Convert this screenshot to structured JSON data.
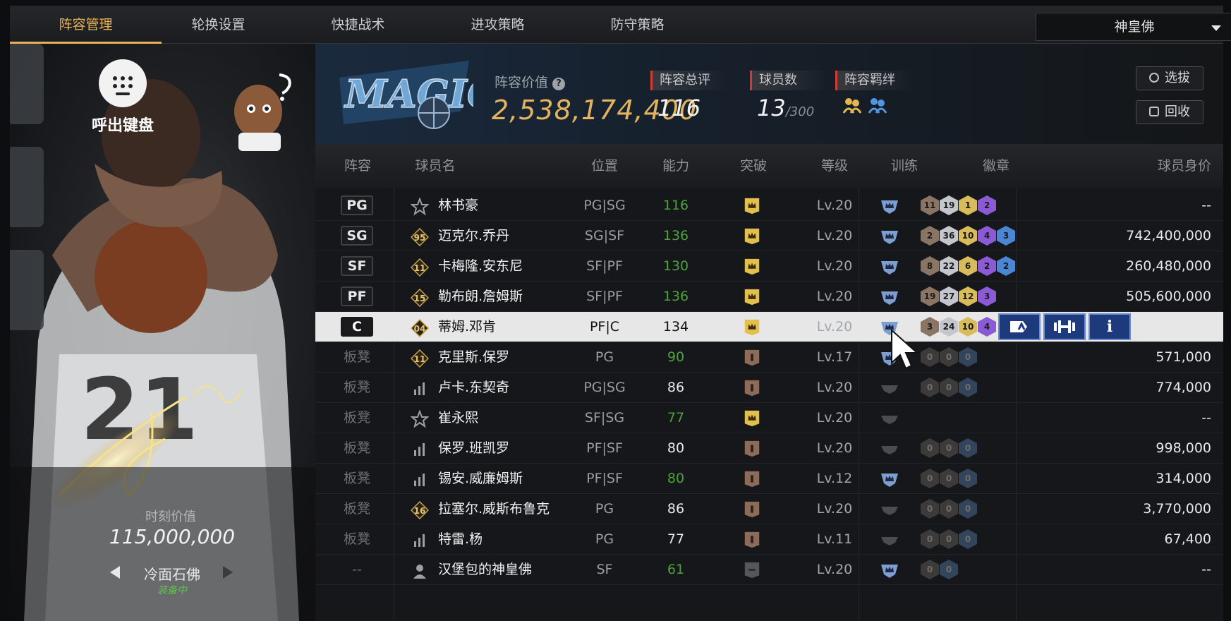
{
  "tabs": [
    {
      "label": "阵容管理",
      "active": true
    },
    {
      "label": "轮换设置",
      "active": false
    },
    {
      "label": "快捷战术",
      "active": false
    },
    {
      "label": "进攻策略",
      "active": false
    },
    {
      "label": "防守策略",
      "active": false
    }
  ],
  "dropdown": {
    "value": "神皇佛"
  },
  "left_panel": {
    "keyboard_label": "呼出键盘",
    "moment_label": "时刻价值",
    "moment_value": "115,000,000",
    "skin_name": "冷面石佛",
    "equipped_label": "装备中"
  },
  "team": {
    "value_label": "阵容价值",
    "help_glyph": "?",
    "value": "2,538,174,400",
    "overall_label": "阵容总评",
    "overall": "116",
    "players_label": "球员数",
    "players": "13",
    "players_max": "/300",
    "bond_label": "阵容羁绊",
    "btn_select": "选拔",
    "btn_recycle": "回收"
  },
  "columns": [
    "阵容",
    "球员名",
    "位置",
    "能力",
    "突破",
    "等级",
    "训练",
    "徽章",
    "球员身价"
  ],
  "rows": [
    {
      "slot": "PG",
      "tier": "star",
      "name": "林书豪",
      "position": "PG|SG",
      "ability": "116",
      "ability_color": "green",
      "break": "gold",
      "level": "Lv.20",
      "train": "blue",
      "badges": [
        "11",
        "19",
        "1",
        "2"
      ],
      "price": "--"
    },
    {
      "slot": "SG",
      "tier": "95",
      "name": "迈克尔.乔丹",
      "position": "SG|SF",
      "ability": "136",
      "ability_color": "green",
      "break": "gold",
      "level": "Lv.20",
      "train": "blue",
      "badges": [
        "2",
        "36",
        "10",
        "4",
        "3"
      ],
      "price": "742,400,000"
    },
    {
      "slot": "SF",
      "tier": "11",
      "name": "卡梅隆.安东尼",
      "position": "SF|PF",
      "ability": "130",
      "ability_color": "green",
      "break": "gold",
      "level": "Lv.20",
      "train": "blue",
      "badges": [
        "8",
        "22",
        "6",
        "2",
        "2"
      ],
      "price": "260,480,000"
    },
    {
      "slot": "PF",
      "tier": "15",
      "name": "勒布朗.詹姆斯",
      "position": "SF|PF",
      "ability": "136",
      "ability_color": "green",
      "break": "gold",
      "level": "Lv.20",
      "train": "blue",
      "badges": [
        "19",
        "27",
        "12",
        "3"
      ],
      "price": "505,600,000"
    },
    {
      "slot": "C",
      "tier": "04",
      "name": "蒂姆.邓肯",
      "position": "PF|C",
      "ability": "134",
      "ability_color": "dark",
      "break": "gold",
      "level": "Lv.20",
      "train": "blue",
      "badges": [
        "3",
        "24",
        "10",
        "4"
      ],
      "price": "",
      "selected": true
    },
    {
      "slot": "板凳",
      "tier": "11",
      "name": "克里斯.保罗",
      "position": "PG",
      "ability": "90",
      "ability_color": "green",
      "break": "bronze",
      "level": "Lv.17",
      "train": "blue",
      "badges": [
        "0",
        "0",
        "0"
      ],
      "price": "571,000"
    },
    {
      "slot": "板凳",
      "tier": "bars",
      "name": "卢卡.东契奇",
      "position": "PG|SG",
      "ability": "86",
      "ability_color": "white",
      "break": "bronze",
      "level": "Lv.20",
      "train": "grey",
      "badges": [
        "0",
        "0",
        "0"
      ],
      "price": "774,000"
    },
    {
      "slot": "板凳",
      "tier": "star",
      "name": "崔永熙",
      "position": "SF|SG",
      "ability": "77",
      "ability_color": "green",
      "break": "gold",
      "level": "Lv.20",
      "train": "grey",
      "badges": [],
      "price": "--"
    },
    {
      "slot": "板凳",
      "tier": "bars",
      "name": "保罗.班凯罗",
      "position": "PF|SF",
      "ability": "80",
      "ability_color": "white",
      "break": "bronze",
      "level": "Lv.20",
      "train": "grey",
      "badges": [
        "0",
        "0",
        "0"
      ],
      "price": "998,000"
    },
    {
      "slot": "板凳",
      "tier": "bars",
      "name": "锡安.威廉姆斯",
      "position": "PF|SF",
      "ability": "80",
      "ability_color": "green",
      "break": "bronze",
      "level": "Lv.12",
      "train": "blue",
      "badges": [
        "0",
        "0",
        "0"
      ],
      "price": "314,000"
    },
    {
      "slot": "板凳",
      "tier": "16",
      "name": "拉塞尔.威斯布鲁克",
      "position": "PG",
      "ability": "86",
      "ability_color": "white",
      "break": "bronze",
      "level": "Lv.20",
      "train": "grey",
      "badges": [
        "0",
        "0",
        "0"
      ],
      "price": "3,770,000"
    },
    {
      "slot": "板凳",
      "tier": "bars",
      "name": "特雷.杨",
      "position": "PG",
      "ability": "77",
      "ability_color": "white",
      "break": "bronze",
      "level": "Lv.11",
      "train": "grey",
      "badges": [
        "0",
        "0",
        "0"
      ],
      "price": "67,400"
    },
    {
      "slot": "--",
      "tier": "person",
      "name": "汉堡包的神皇佛",
      "position": "SF",
      "ability": "61",
      "ability_color": "green",
      "break": "none",
      "level": "Lv.20",
      "train": "blue",
      "badges": [
        "0",
        "0"
      ],
      "price": "--"
    }
  ],
  "colors": {
    "accent": "#e7b257",
    "green": "#4ba33a",
    "selected_bg": "#e7e7e7",
    "action_blue": "#1c3a7c"
  }
}
